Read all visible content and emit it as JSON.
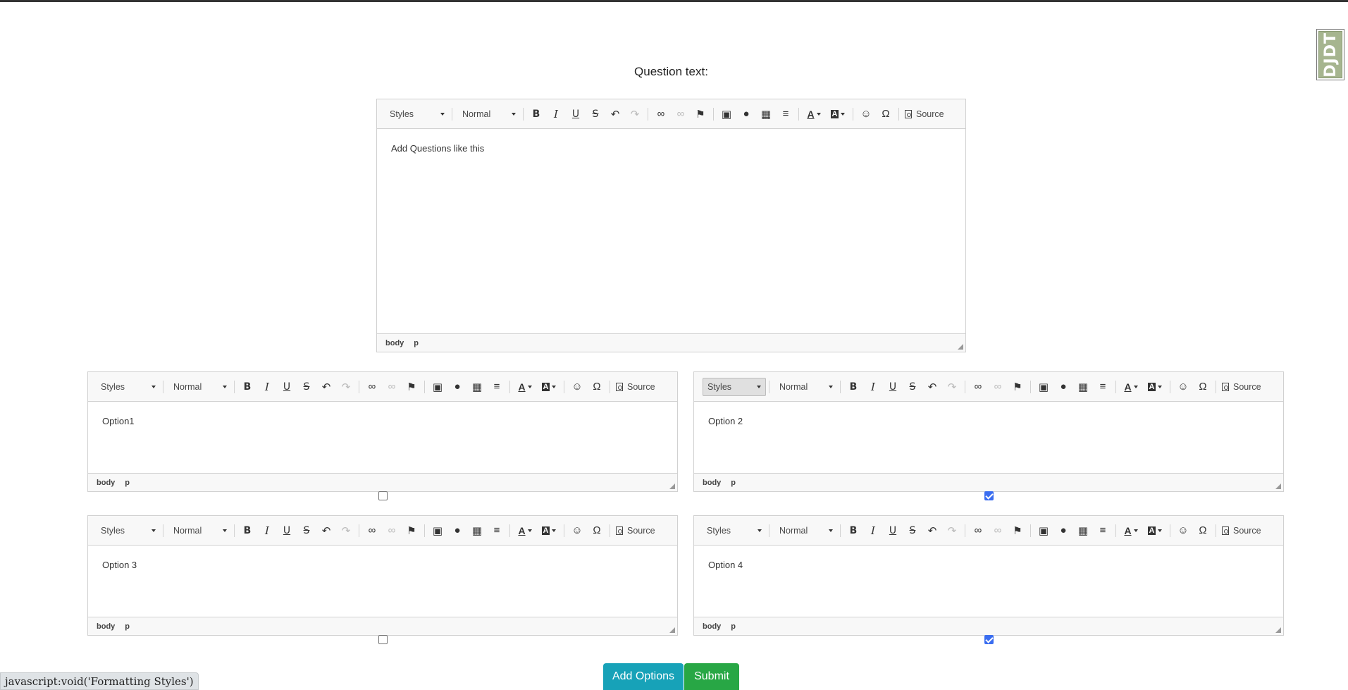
{
  "question_label": "Question text:",
  "debug_toolbar_label": "DJDT",
  "toolbar": {
    "styles_label": "Styles",
    "format_label": "Normal",
    "source_label": "Source"
  },
  "editors": [
    {
      "content": "Add Questions like this",
      "path": [
        "body",
        "p"
      ],
      "correct": false
    },
    {
      "content": "Option1",
      "path": [
        "body",
        "p"
      ],
      "correct": false
    },
    {
      "content": "Option 2",
      "path": [
        "body",
        "p"
      ],
      "correct": true
    },
    {
      "content": "Option 3",
      "path": [
        "body",
        "p"
      ],
      "correct": false
    },
    {
      "content": "Option 4",
      "path": [
        "body",
        "p"
      ],
      "correct": true
    }
  ],
  "buttons": {
    "add_options": "Add Options",
    "submit": "Submit"
  },
  "browser_status": "javascript:void('Formatting Styles')",
  "colors": {
    "add_options": "#17a2b8",
    "submit": "#28a745",
    "checkbox_checked": "#3a6df0"
  }
}
